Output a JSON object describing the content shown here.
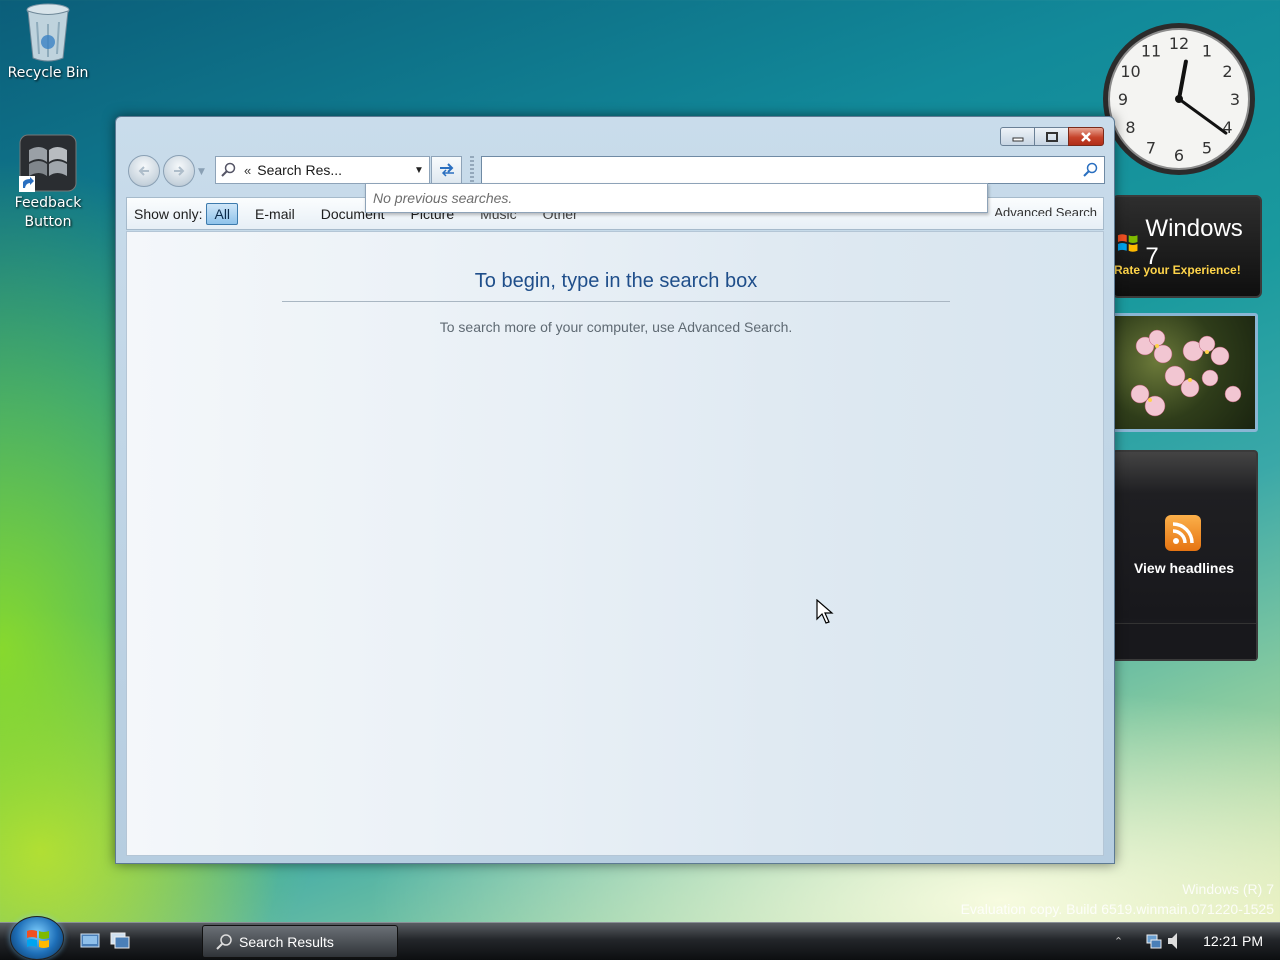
{
  "desktop": {
    "icons": [
      {
        "label": "Recycle Bin"
      },
      {
        "label_line1": "Feedback",
        "label_line2": "Button"
      }
    ],
    "watermark": {
      "line1": "Windows (R) 7",
      "line2": "Evaluation copy. Build 6519.winmain.071220-1525"
    }
  },
  "gadgets": {
    "clock": {
      "numbers": [
        "12",
        "1",
        "2",
        "3",
        "4",
        "5",
        "6",
        "7",
        "8",
        "9",
        "10",
        "11"
      ],
      "hour": 12,
      "minute": 21
    },
    "windows7": {
      "title": "Windows 7",
      "subtitle": "Rate your Experience!"
    },
    "feed": {
      "label": "View headlines"
    }
  },
  "window": {
    "address": {
      "chevron": "«",
      "text": "Search Res..."
    },
    "search": {
      "value": "",
      "dropdown_text": "No previous searches."
    },
    "filter": {
      "show_only": "Show only:",
      "buttons": [
        "All",
        "E-mail",
        "Document",
        "Picture",
        "Music",
        "Other"
      ],
      "active": "All",
      "advanced": "Advanced Search"
    },
    "content": {
      "title": "To begin, type in the search box",
      "subtitle": "To search more of your computer, use Advanced Search."
    }
  },
  "taskbar": {
    "task_button": "Search Results",
    "clock": "12:21 PM"
  },
  "colors": {
    "content_title": "#1f4e8a",
    "close_button": "#c6432a",
    "filter_active": "#8fc3eb"
  }
}
